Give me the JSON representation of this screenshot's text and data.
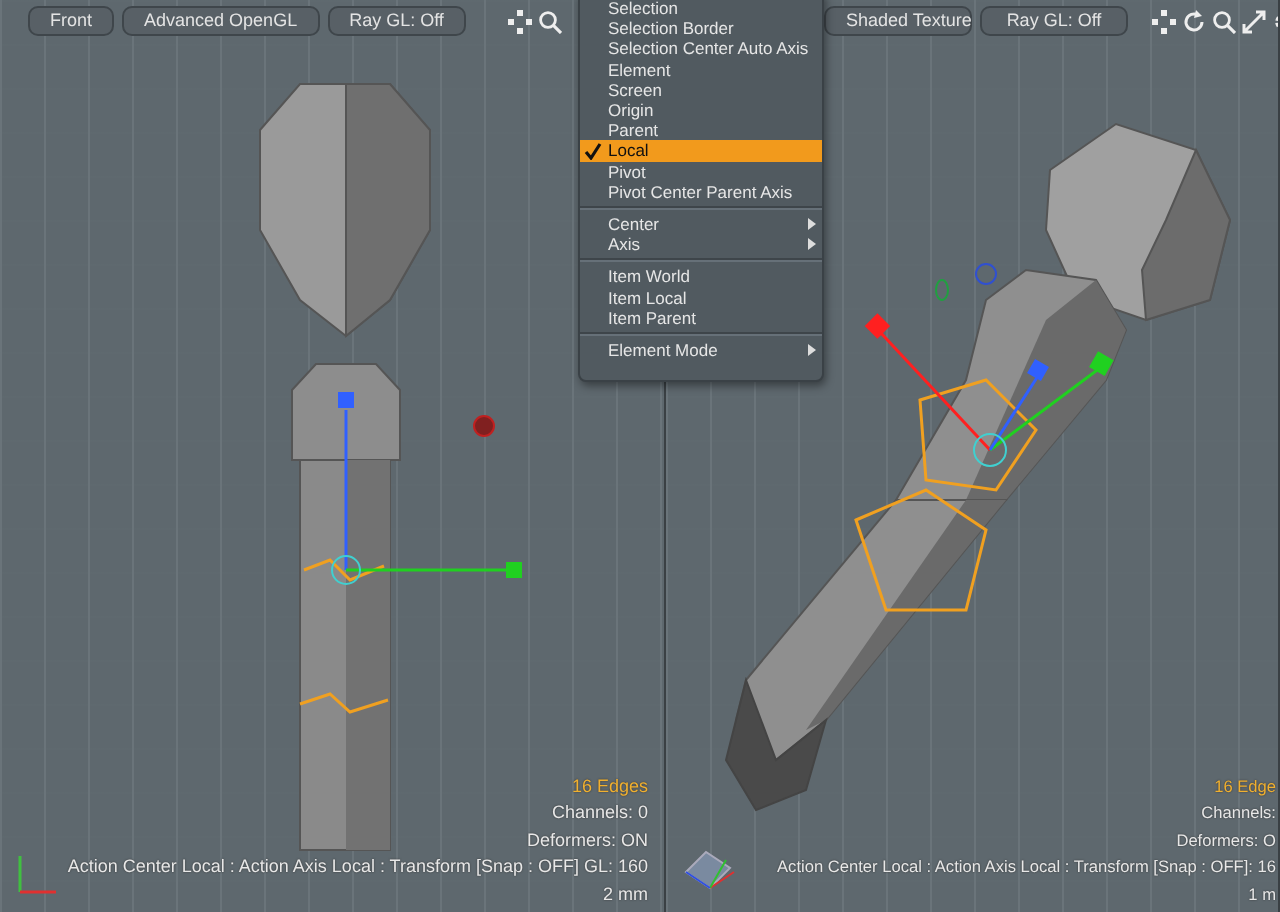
{
  "viewports": [
    {
      "kind": "front",
      "toolbar": [
        "Front",
        "Advanced OpenGL",
        "Ray GL: Off"
      ],
      "status": [
        {
          "kind": "count",
          "text": "16 Edges"
        },
        {
          "kind": "info",
          "text": "Channels: 0"
        },
        {
          "kind": "info",
          "text": "Deformers: ON"
        },
        {
          "kind": "info",
          "text": "Action Center Local : Action Axis Local : Transform  [Snap : OFF]  GL: 160"
        },
        {
          "kind": "info",
          "text": "2 mm"
        }
      ]
    },
    {
      "kind": "perspective",
      "toolbar": [
        "Shaded Texture",
        "Ray GL: Off"
      ],
      "status": [
        {
          "kind": "count",
          "text": "16 Edge"
        },
        {
          "kind": "info",
          "text": "Channels:"
        },
        {
          "kind": "info",
          "text": "Deformers: O"
        },
        {
          "kind": "info",
          "text": "Action Center Local : Action Axis Local : Transform  [Snap : OFF]: 16"
        },
        {
          "kind": "info",
          "text": "1 m"
        }
      ]
    }
  ],
  "menu": {
    "groups": [
      [
        {
          "label": "Selection",
          "checked": false,
          "selected": false,
          "submenu": false
        },
        {
          "label": "Selection Border",
          "checked": false,
          "selected": false,
          "submenu": false
        },
        {
          "label": "Selection Center Auto Axis",
          "checked": false,
          "selected": false,
          "submenu": false
        },
        {
          "label": "Element",
          "checked": false,
          "selected": false,
          "submenu": false
        },
        {
          "label": "Screen",
          "checked": false,
          "selected": false,
          "submenu": false
        },
        {
          "label": "Origin",
          "checked": false,
          "selected": false,
          "submenu": false
        },
        {
          "label": "Parent",
          "checked": false,
          "selected": false,
          "submenu": false
        },
        {
          "label": "Local",
          "checked": true,
          "selected": true,
          "submenu": false
        },
        {
          "label": "Pivot",
          "checked": false,
          "selected": false,
          "submenu": false
        },
        {
          "label": "Pivot Center Parent Axis",
          "checked": false,
          "selected": false,
          "submenu": false
        }
      ],
      [
        {
          "label": "Center",
          "checked": false,
          "selected": false,
          "submenu": true
        },
        {
          "label": "Axis",
          "checked": false,
          "selected": false,
          "submenu": true
        }
      ],
      [
        {
          "label": "Item World",
          "checked": false,
          "selected": false,
          "submenu": false
        },
        {
          "label": "Item Local",
          "checked": false,
          "selected": false,
          "submenu": false
        },
        {
          "label": "Item Parent",
          "checked": false,
          "selected": false,
          "submenu": false
        }
      ],
      [
        {
          "label": "Element Mode",
          "checked": false,
          "selected": false,
          "submenu": true
        }
      ]
    ]
  }
}
